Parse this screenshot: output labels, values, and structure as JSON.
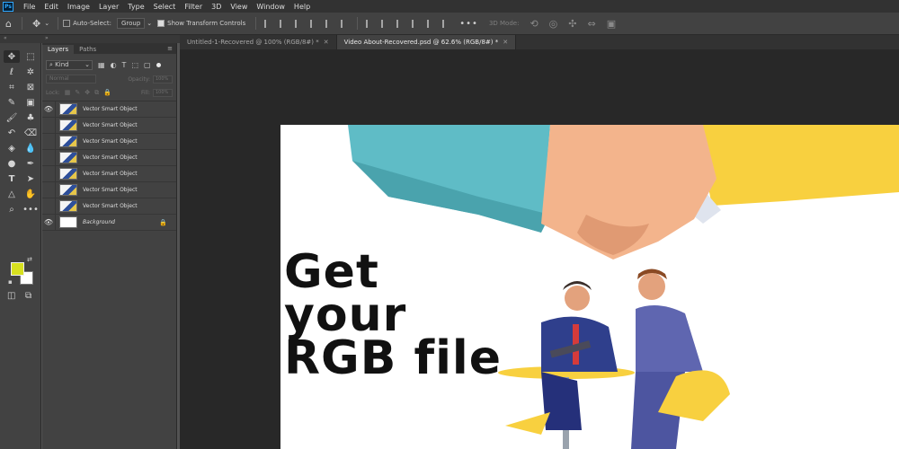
{
  "menubar": {
    "logo": "Ps",
    "items": [
      "File",
      "Edit",
      "Image",
      "Layer",
      "Type",
      "Select",
      "Filter",
      "3D",
      "View",
      "Window",
      "Help"
    ]
  },
  "options": {
    "auto_select_label": "Auto-Select:",
    "auto_select_value": "Group",
    "transform_label": "Show Transform Controls",
    "mode_3d_label": "3D Mode:",
    "more": "•••"
  },
  "panel": {
    "tabs": [
      "Layers",
      "Paths"
    ],
    "kind_label": "Kind",
    "blend_mode": "Normal",
    "opacity_label": "Opacity:",
    "opacity_value": "100%",
    "lock_label": "Lock:",
    "fill_label": "Fill:",
    "fill_value": "100%"
  },
  "layers": [
    {
      "name": "Vector Smart Object",
      "visible": true
    },
    {
      "name": "Vector Smart Object",
      "visible": false
    },
    {
      "name": "Vector Smart Object",
      "visible": false
    },
    {
      "name": "Vector Smart Object",
      "visible": false
    },
    {
      "name": "Vector Smart Object",
      "visible": false
    },
    {
      "name": "Vector Smart Object",
      "visible": false
    },
    {
      "name": "Vector Smart Object",
      "visible": false
    },
    {
      "name": "Background",
      "visible": true,
      "locked": true
    }
  ],
  "documents": [
    {
      "title": "Untitled-1-Recovered @ 100% (RGB/8#) *",
      "active": false
    },
    {
      "title": "Video About-Recovered.psd @ 62.6% (RGB/8#) *",
      "active": true
    }
  ],
  "canvas": {
    "headline": [
      "Get",
      "your",
      "RGB file"
    ]
  },
  "colors": {
    "foreground": "#d7e01f",
    "background": "#ffffff"
  }
}
